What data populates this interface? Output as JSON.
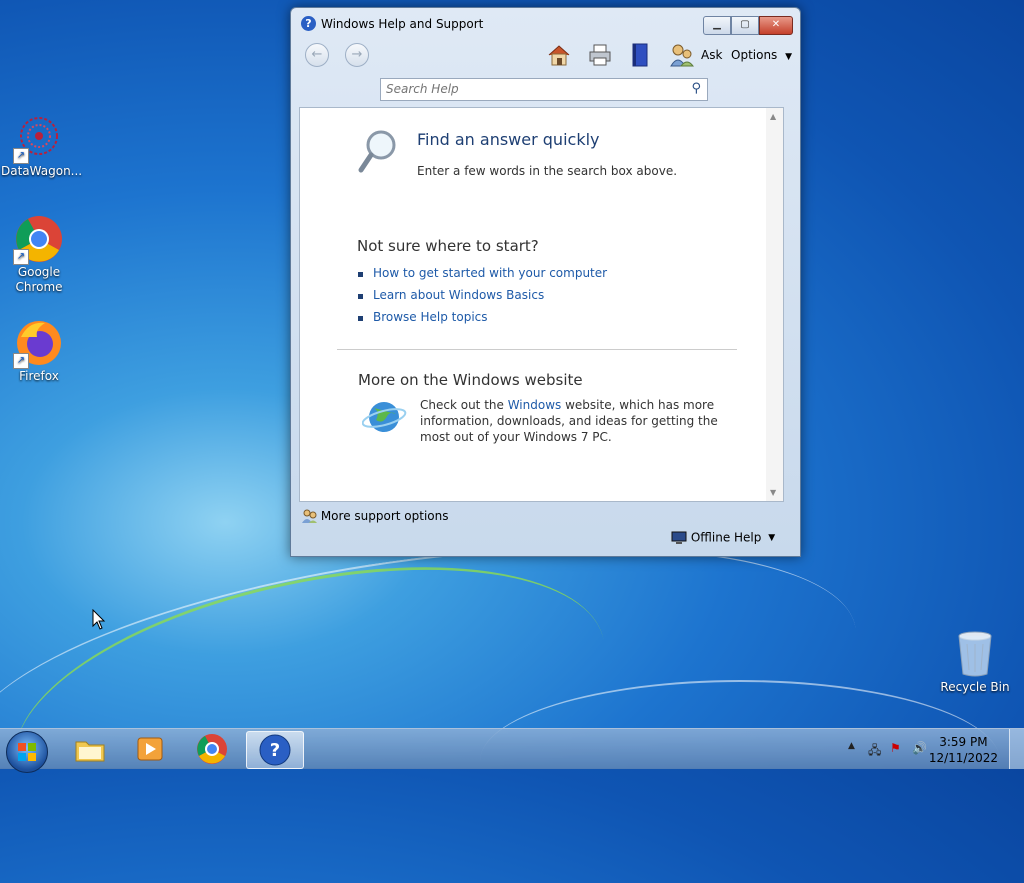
{
  "desktop": {
    "icons": [
      {
        "label": "DataWagon..."
      },
      {
        "label": "Google\nChrome"
      },
      {
        "label": "Firefox"
      },
      {
        "label": "Recycle Bin"
      }
    ]
  },
  "window": {
    "title": "Windows Help and Support",
    "toolbar": {
      "ask_label": "Ask",
      "options_label": "Options"
    },
    "search": {
      "placeholder": "Search Help"
    },
    "content": {
      "find_title": "Find an answer quickly",
      "find_desc": "Enter a few words in the search box above.",
      "start_title": "Not sure where to start?",
      "links": [
        "How to get started with your computer",
        "Learn about Windows Basics",
        "Browse Help topics"
      ],
      "website_title": "More on the Windows website",
      "website_text_pre": "Check out the ",
      "website_link": "Windows",
      "website_text_post": " website, which has more information, downloads, and ideas for getting the most out of your Windows 7 PC."
    },
    "footer": {
      "more_support": "More support options",
      "offline_help": "Offline Help"
    }
  },
  "taskbar": {
    "clock_time": "3:59 PM",
    "clock_date": "12/11/2022"
  }
}
